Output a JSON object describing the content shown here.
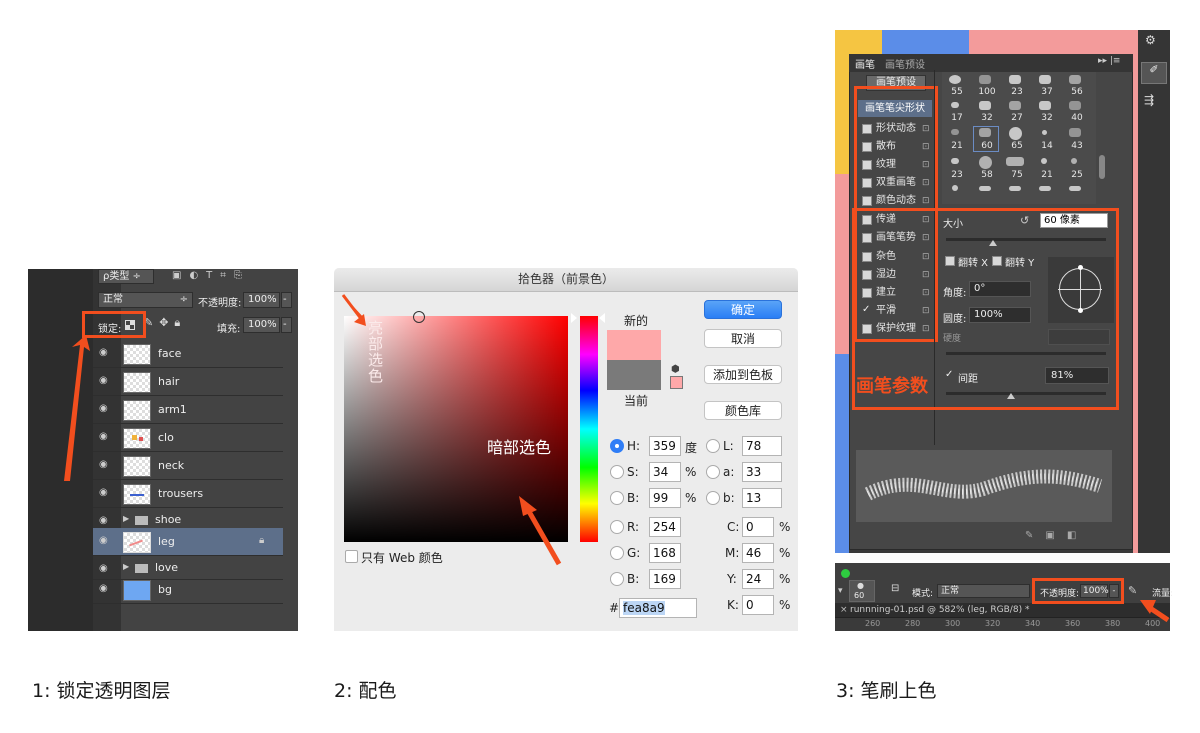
{
  "layers_panel": {
    "filter_kind": "ρ类型",
    "blend_mode": "正常",
    "opacity_label": "不透明度:",
    "opacity_value": "100%",
    "lock_label": "锁定:",
    "fill_label": "填充:",
    "fill_value": "100%",
    "layers": [
      {
        "name": "face"
      },
      {
        "name": "hair"
      },
      {
        "name": "arm1"
      },
      {
        "name": "clo"
      },
      {
        "name": "neck"
      },
      {
        "name": "trousers"
      },
      {
        "name": "shoe"
      },
      {
        "name": "leg"
      },
      {
        "name": "love"
      },
      {
        "name": "bg"
      }
    ]
  },
  "color_picker": {
    "title": "拾色器（前景色）",
    "annotation_highlight": "亮部选色",
    "annotation_shadow": "暗部选色",
    "new_label": "新的",
    "current_label": "当前",
    "new_color": "#fea8a9",
    "current_color": "#7a7a7a",
    "ok_button": "确定",
    "cancel_button": "取消",
    "add_swatch_button": "添加到色板",
    "color_library_button": "颜色库",
    "web_only_label": "只有 Web 颜色",
    "fields": {
      "H": "359",
      "H_unit": "度",
      "S": "34",
      "S_unit": "%",
      "B": "99",
      "B_unit": "%",
      "R": "254",
      "G": "168",
      "Bv": "169",
      "L": "78",
      "a": "33",
      "b": "13",
      "C": "0",
      "M": "46",
      "Y": "24",
      "K": "0",
      "pct": "%"
    },
    "hex_label": "#",
    "hex_value": "fea8a9"
  },
  "brush_panel": {
    "tab_brush": "画笔",
    "tab_presets": "画笔预设",
    "preset_button": "画笔预设",
    "tip_shape": "画笔笔尖形状",
    "options": [
      {
        "label": "形状动态",
        "checked": false
      },
      {
        "label": "散布",
        "checked": false
      },
      {
        "label": "纹理",
        "checked": false
      },
      {
        "label": "双重画笔",
        "checked": false
      },
      {
        "label": "颜色动态",
        "checked": false
      },
      {
        "label": "传递",
        "checked": false
      },
      {
        "label": "画笔笔势",
        "checked": false
      },
      {
        "label": "杂色",
        "checked": false
      },
      {
        "label": "湿边",
        "checked": false
      },
      {
        "label": "建立",
        "checked": false
      },
      {
        "label": "平滑",
        "checked": true
      },
      {
        "label": "保护纹理",
        "checked": false
      }
    ],
    "tip_sizes": [
      "55",
      "100",
      "23",
      "37",
      "56",
      "17",
      "32",
      "27",
      "32",
      "40",
      "21",
      "60",
      "65",
      "14",
      "43",
      "23",
      "58",
      "75",
      "21",
      "25"
    ],
    "size_label": "大小",
    "size_value": "60 像素",
    "flip_x": "翻转 X",
    "flip_y": "翻转 Y",
    "angle_label": "角度:",
    "angle_value": "0°",
    "roundness_label": "圆度:",
    "roundness_value": "100%",
    "hardness_label": "硬度",
    "spacing_label": "间距",
    "spacing_value": "81%",
    "annotation": "画笔参数"
  },
  "options_bar": {
    "brush_size": "60",
    "mode_label": "模式:",
    "mode_value": "正常",
    "opacity_label": "不透明度:",
    "opacity_value": "100%",
    "flow_label": "流量:",
    "doc_tab": "runnning-01.psd @ 582% (leg, RGB/8) *",
    "ruler": [
      "260",
      "280",
      "300",
      "320",
      "340",
      "360",
      "380",
      "400"
    ]
  },
  "captions": {
    "c1": "1:  锁定透明图层",
    "c2": "2:  配色",
    "c3": "3:  笔刷上色"
  },
  "colors": {
    "accent": "#f24e1e",
    "ps_dark": "#3c3c3c",
    "selected_layer": "#5d6f8a"
  }
}
